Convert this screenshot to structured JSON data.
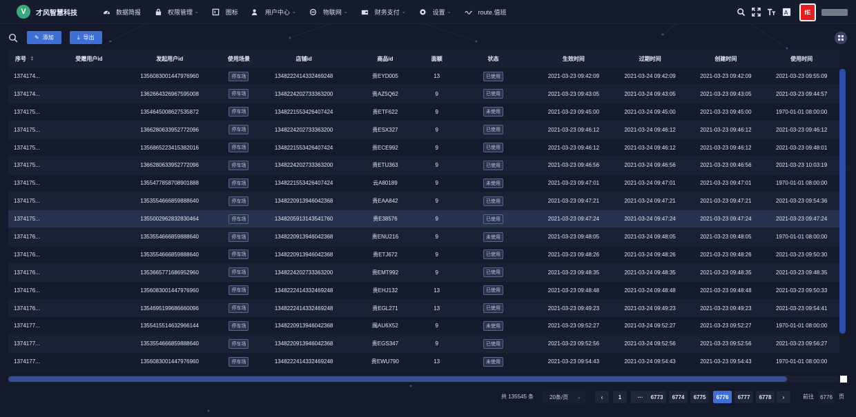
{
  "brand": {
    "logo_letter": "V",
    "name": "才风智慧科技"
  },
  "nav": [
    {
      "label": "数据简报",
      "icon": "dashboard-icon",
      "caret": false
    },
    {
      "label": "权限管理",
      "icon": "lock-icon",
      "caret": true
    },
    {
      "label": "图标",
      "icon": "image-icon",
      "caret": false
    },
    {
      "label": "用户中心",
      "icon": "user-icon",
      "caret": true
    },
    {
      "label": "物联网",
      "icon": "network-icon",
      "caret": true
    },
    {
      "label": "财务支付",
      "icon": "wallet-icon",
      "caret": true
    },
    {
      "label": "设置",
      "icon": "gear-icon",
      "caret": true
    },
    {
      "label": "route.值班",
      "icon": "wave-icon",
      "caret": false
    }
  ],
  "header_tools": [
    "search-icon",
    "fullscreen-icon",
    "font-size-icon",
    "translate-icon"
  ],
  "avatar_text": "fE",
  "toolbar": {
    "add_label": "添加",
    "export_label": "导出"
  },
  "table": {
    "columns": [
      "序号",
      "受赠用户id",
      "发起用户id",
      "使用场景",
      "店铺id",
      "商品id",
      "面额",
      "状态",
      "生效时间",
      "过期时间",
      "创建时间",
      "使用时间"
    ],
    "rows": [
      [
        "1374174...",
        "",
        "1356083001447976960",
        "停车场",
        "1348222414332469248",
        "贵EYD005",
        "13",
        "已使用",
        "2021-03-23 09:42:09",
        "2021-03-24 09:42:09",
        "2021-03-23 09:42:09",
        "2021-03-23 09:55:09"
      ],
      [
        "1374174...",
        "",
        "1362664326967595008",
        "停车场",
        "1348224202733363200",
        "贵AZ5Q62",
        "9",
        "已使用",
        "2021-03-23 09:43:05",
        "2021-03-24 09:43:05",
        "2021-03-23 09:43:05",
        "2021-03-23 09:44:57"
      ],
      [
        "1374175...",
        "",
        "1354645008627535872",
        "停车场",
        "1348221553426407424",
        "贵ETF622",
        "9",
        "未使用",
        "2021-03-23 09:45:00",
        "2021-03-24 09:45:00",
        "2021-03-23 09:45:00",
        "1970-01-01 08:00:00"
      ],
      [
        "1374175...",
        "",
        "1366280633952772096",
        "停车场",
        "1348224202733363200",
        "贵ESX327",
        "9",
        "已使用",
        "2021-03-23 09:46:12",
        "2021-03-24 09:46:12",
        "2021-03-23 09:46:12",
        "2021-03-23 09:46:12"
      ],
      [
        "1374175...",
        "",
        "1356865223415382016",
        "停车场",
        "1348221553426407424",
        "贵ECE992",
        "9",
        "已使用",
        "2021-03-23 09:46:12",
        "2021-03-24 09:46:12",
        "2021-03-23 09:46:12",
        "2021-03-23 09:48:01"
      ],
      [
        "1374175...",
        "",
        "1366280633952772096",
        "停车场",
        "1348224202733363200",
        "贵ETU363",
        "9",
        "已使用",
        "2021-03-23 09:46:56",
        "2021-03-24 09:46:56",
        "2021-03-23 09:46:56",
        "2021-03-23 10:03:19"
      ],
      [
        "1374175...",
        "",
        "1355477858708901888",
        "停车场",
        "1348221553426407424",
        "云A80189",
        "9",
        "未使用",
        "2021-03-23 09:47:01",
        "2021-03-24 09:47:01",
        "2021-03-23 09:47:01",
        "1970-01-01 08:00:00"
      ],
      [
        "1374175...",
        "",
        "1353554666859888640",
        "停车场",
        "1348220913946042368",
        "贵EAA842",
        "9",
        "已使用",
        "2021-03-23 09:47:21",
        "2021-03-24 09:47:21",
        "2021-03-23 09:47:21",
        "2021-03-23 09:54:36"
      ],
      [
        "1374175...",
        "",
        "1355002962832830464",
        "停车场",
        "1348205913143541760",
        "贵E38576",
        "9",
        "已使用",
        "2021-03-23 09:47:24",
        "2021-03-24 09:47:24",
        "2021-03-23 09:47:24",
        "2021-03-23 09:47:24"
      ],
      [
        "1374176...",
        "",
        "1353554666859888640",
        "停车场",
        "1348220913946042368",
        "贵ENU216",
        "9",
        "未使用",
        "2021-03-23 09:48:05",
        "2021-03-24 09:48:05",
        "2021-03-23 09:48:05",
        "1970-01-01 08:00:00"
      ],
      [
        "1374176...",
        "",
        "1353554666859888640",
        "停车场",
        "1348220913946042368",
        "贵ETJ672",
        "9",
        "已使用",
        "2021-03-23 09:48:26",
        "2021-03-24 09:48:26",
        "2021-03-23 09:48:26",
        "2021-03-23 09:50:30"
      ],
      [
        "1374176...",
        "",
        "1353665771686952960",
        "停车场",
        "1348224202733363200",
        "贵EMT992",
        "9",
        "已使用",
        "2021-03-23 09:48:35",
        "2021-03-24 09:48:35",
        "2021-03-23 09:48:35",
        "2021-03-23 09:48:35"
      ],
      [
        "1374176...",
        "",
        "1356083001447976960",
        "停车场",
        "1348222414332469248",
        "贵EHJ132",
        "13",
        "已使用",
        "2021-03-23 09:48:48",
        "2021-03-24 09:48:48",
        "2021-03-23 09:48:48",
        "2021-03-23 09:50:33"
      ],
      [
        "1374176...",
        "",
        "1354695199686660096",
        "停车场",
        "1348222414332469248",
        "贵EGL271",
        "13",
        "已使用",
        "2021-03-23 09:49:23",
        "2021-03-24 09:49:23",
        "2021-03-23 09:49:23",
        "2021-03-23 09:54:41"
      ],
      [
        "1374177...",
        "",
        "1355415514632966144",
        "停车场",
        "1348220913946042368",
        "闽AU6X52",
        "9",
        "未使用",
        "2021-03-23 09:52:27",
        "2021-03-24 09:52:27",
        "2021-03-23 09:52:27",
        "1970-01-01 08:00:00"
      ],
      [
        "1374177...",
        "",
        "1353554666859888640",
        "停车场",
        "1348220913946042368",
        "贵EGS347",
        "9",
        "已使用",
        "2021-03-23 09:52:56",
        "2021-03-24 09:52:56",
        "2021-03-23 09:52:56",
        "2021-03-23 09:56:27"
      ],
      [
        "1374177...",
        "",
        "1356083001447976960",
        "停车场",
        "1348222414332469248",
        "贵EWU790",
        "13",
        "未使用",
        "2021-03-23 09:54:43",
        "2021-03-24 09:54:43",
        "2021-03-23 09:54:43",
        "1970-01-01 08:00:00"
      ]
    ],
    "highlighted_row": 8
  },
  "pagination": {
    "total_text": "共 135545 条",
    "page_size": "20条/页",
    "pages": [
      "1",
      "···",
      "6773",
      "6774",
      "6775",
      "6776",
      "6777",
      "6778"
    ],
    "current": "6776",
    "jump_label": "前往",
    "jump_value": "6776",
    "jump_unit": "页"
  },
  "colors": {
    "accent": "#3f6fd6",
    "header_bg": "#161c2e",
    "page_bg": "#141a2c",
    "avatar": "#e02121",
    "logo": "#3aa87d"
  }
}
